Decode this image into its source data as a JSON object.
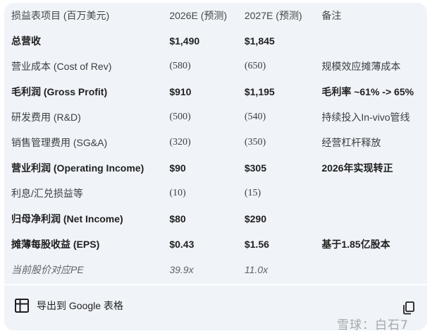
{
  "table": {
    "headers": [
      "损益表项目 (百万美元)",
      "2026E (预测)",
      "2027E (预测)",
      "备注"
    ],
    "rows": [
      {
        "item": "总营收",
        "y2026": "$1,490",
        "y2027": "$1,845",
        "note": ""
      },
      {
        "item": "营业成本 (Cost of Rev)",
        "y2026": "(580)",
        "y2027": "(650)",
        "note": "规模效应摊薄成本"
      },
      {
        "item": "毛利润 (Gross Profit)",
        "y2026": "$910",
        "y2027": "$1,195",
        "note": "毛利率 ~61% -> 65%"
      },
      {
        "item": "研发费用 (R&D)",
        "y2026": "(500)",
        "y2027": "(540)",
        "note": "持续投入In-vivo管线"
      },
      {
        "item": "销售管理费用 (SG&A)",
        "y2026": "(320)",
        "y2027": "(350)",
        "note": "经营杠杆释放"
      },
      {
        "item": "营业利润 (Operating Income)",
        "y2026": "$90",
        "y2027": "$305",
        "note": "2026年实现转正"
      },
      {
        "item": "利息/汇兑损益等",
        "y2026": "(10)",
        "y2027": "(15)",
        "note": ""
      },
      {
        "item": "归母净利润 (Net Income)",
        "y2026": "$80",
        "y2027": "$290",
        "note": ""
      },
      {
        "item": "摊薄每股收益 (EPS)",
        "y2026": "$0.43",
        "y2027": "$1.56",
        "note": "基于1.85亿股本"
      },
      {
        "item": "当前股价对应PE",
        "y2026": "39.9x",
        "y2027": "11.0x",
        "note": ""
      }
    ]
  },
  "footer": {
    "export_label": "导出到 Google 表格",
    "export_icon": "sheets-icon",
    "copy_icon": "copy-icon"
  },
  "watermark": "雪球：白石7"
}
